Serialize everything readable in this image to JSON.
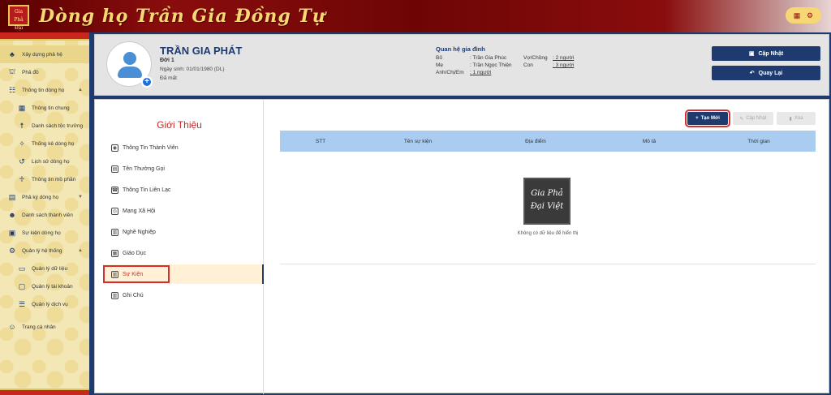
{
  "header": {
    "logo_text": "Gia Phả Đại Việt",
    "site_title": "Dòng họ Trần Gia Đồng Tự",
    "icons": [
      "app-grid-icon",
      "gear-icon"
    ]
  },
  "sidebar": {
    "items": [
      {
        "label": "Xây dựng phả hệ",
        "icon": "tree-icon",
        "active": true
      },
      {
        "label": "Phả đồ",
        "icon": "hierarchy-icon"
      },
      {
        "label": "Thông tin dòng họ",
        "icon": "family-icon",
        "expand": true
      },
      {
        "label": "Thông tin chung",
        "icon": "grid-icon",
        "sub": true
      },
      {
        "label": "Danh sách tộc trưởng",
        "icon": "person-icon",
        "sub": true
      },
      {
        "label": "Thống kê dòng họ",
        "icon": "chart-icon",
        "sub": true
      },
      {
        "label": "Lịch sử dòng họ",
        "icon": "history-icon",
        "sub": true
      },
      {
        "label": "Thông tin mồ phần",
        "icon": "grave-icon",
        "sub": true
      },
      {
        "label": "Phả ký dòng họ",
        "icon": "book-icon",
        "expand": true
      },
      {
        "label": "Danh sách thành viên",
        "icon": "users-icon"
      },
      {
        "label": "Sự kiện dòng họ",
        "icon": "calendar-icon"
      },
      {
        "label": "Quản lý hệ thống",
        "icon": "cog-icon",
        "expand": true
      },
      {
        "label": "Quản lý dữ liệu",
        "icon": "database-icon",
        "sub": true
      },
      {
        "label": "Quản lý tài khoản",
        "icon": "account-icon",
        "sub": true
      },
      {
        "label": "Quản lý dịch vụ",
        "icon": "list-icon",
        "sub": true
      },
      {
        "label": "Trang cá nhân",
        "icon": "profile-icon"
      }
    ]
  },
  "profile": {
    "name": "TRẦN GIA PHÁT",
    "generation": "Đời 1",
    "dob": "Ngày sinh: 01/01/1980 (DL)",
    "status": "Đã mất"
  },
  "relations": {
    "title": "Quan hệ gia đình",
    "father_label": "Bố",
    "father_value": ": Trần Gia Phúc",
    "spouse_label": "Vợ/Chồng",
    "spouse_value": ": 2 người",
    "mother_label": "Mẹ",
    "mother_value": ": Trần Ngọc Thiện",
    "children_label": "Con",
    "children_value": ": 3 người",
    "siblings_label": "Anh/Chị/Em",
    "siblings_value": ": 1 người"
  },
  "actions": {
    "update_label": "Cập Nhật",
    "back_label": "Quay Lại"
  },
  "intro": {
    "title": "Giới Thiệu",
    "tabs": [
      {
        "label": "Thông Tin Thành Viên",
        "icon": "user-circle-icon"
      },
      {
        "label": "Tên Thường Gọi",
        "icon": "id-card-icon"
      },
      {
        "label": "Thông Tin Liên Lạc",
        "icon": "contact-icon"
      },
      {
        "label": "Mạng Xã Hội",
        "icon": "instagram-icon"
      },
      {
        "label": "Nghề Nghiệp",
        "icon": "briefcase-icon"
      },
      {
        "label": "Giáo Dục",
        "icon": "education-icon"
      },
      {
        "label": "Sự Kiện",
        "icon": "event-icon",
        "active": true
      },
      {
        "label": "Ghi Chú",
        "icon": "note-icon"
      }
    ]
  },
  "events": {
    "create_label": "Tạo Mới",
    "edit_label": "Cập Nhật",
    "delete_label": "Xóa",
    "columns": [
      "STT",
      "Tên sự kiện",
      "Địa điểm",
      "Mô tả",
      "Thời gian"
    ],
    "empty_logo_text": "Gia Phả Đại Việt",
    "empty_message": "Không có dữ liệu để hiển thị"
  }
}
